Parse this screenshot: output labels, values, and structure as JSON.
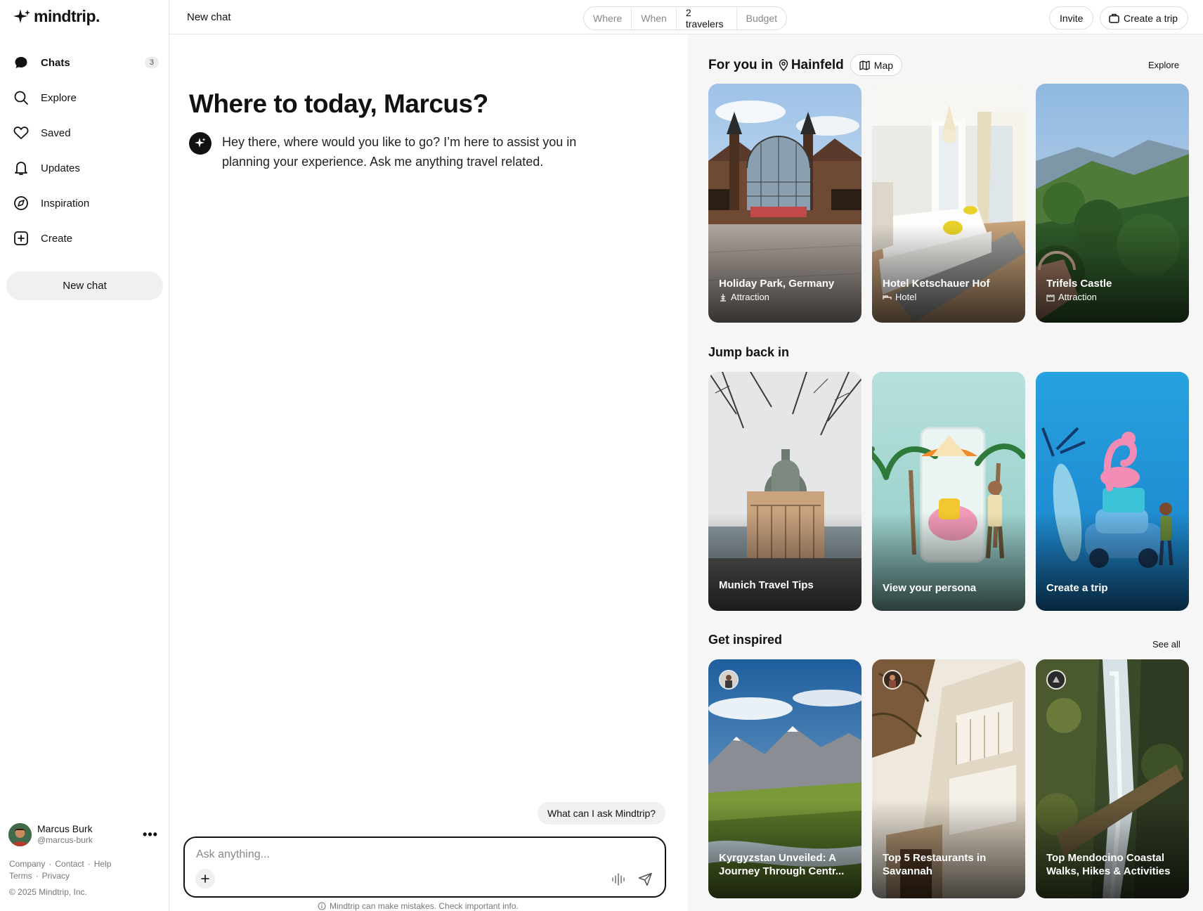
{
  "app": {
    "logo_text": "mindtrip."
  },
  "sidebar": {
    "items": [
      {
        "label": "Chats",
        "count": "3",
        "icon": "chat-bubble-icon"
      },
      {
        "label": "Explore",
        "icon": "search-icon"
      },
      {
        "label": "Saved",
        "icon": "heart-icon"
      },
      {
        "label": "Updates",
        "icon": "bell-icon"
      },
      {
        "label": "Inspiration",
        "icon": "compass-icon"
      },
      {
        "label": "Create",
        "icon": "plus-square-icon"
      }
    ],
    "new_chat_label": "New chat",
    "user": {
      "name": "Marcus Burk",
      "handle": "@marcus-burk",
      "more": "•••"
    },
    "footer": {
      "company": "Company",
      "contact": "Contact",
      "help": "Help",
      "terms": "Terms",
      "privacy": "Privacy",
      "copyright": "© 2025 Mindtrip, Inc."
    }
  },
  "header": {
    "title": "New chat",
    "filters": {
      "where": "Where",
      "when": "When",
      "travelers": "2 travelers",
      "budget": "Budget"
    },
    "invite_label": "Invite",
    "create_trip_label": "Create a trip"
  },
  "chat": {
    "greeting": "Where to today, Marcus?",
    "bot_message": "Hey there, where would you like to go? I’m here to assist you in planning your experience. Ask me anything travel related.",
    "suggestion": "What can I ask Mindtrip?",
    "input_placeholder": "Ask anything...",
    "disclaimer": "Mindtrip can make mistakes. Check important info."
  },
  "discover": {
    "for_you": {
      "prefix": "For you in",
      "location": "Hainfeld",
      "map_label": "Map",
      "explore_label": "Explore",
      "cards": [
        {
          "title": "Holiday Park, Germany",
          "type": "Attraction"
        },
        {
          "title": "Hotel Ketschauer Hof",
          "type": "Hotel"
        },
        {
          "title": "Trifels Castle",
          "type": "Attraction"
        }
      ]
    },
    "jump_back": {
      "title": "Jump back in",
      "cards": [
        {
          "title": "Munich Travel Tips"
        },
        {
          "title": "View your persona"
        },
        {
          "title": "Create a trip"
        }
      ]
    },
    "inspired": {
      "title": "Get inspired",
      "see_all_label": "See all",
      "cards": [
        {
          "title": "Kyrgyzstan Unveiled: A Journey Through Centr..."
        },
        {
          "title": "Top 5 Restaurants in Savannah"
        },
        {
          "title": "Top Mendocino Coastal Walks, Hikes & Activities"
        }
      ]
    }
  },
  "colors": {
    "accent": "#111111",
    "panel_bg": "#f6f6f6",
    "chip_bg": "#f0f0f0",
    "muted_text": "#777777"
  }
}
